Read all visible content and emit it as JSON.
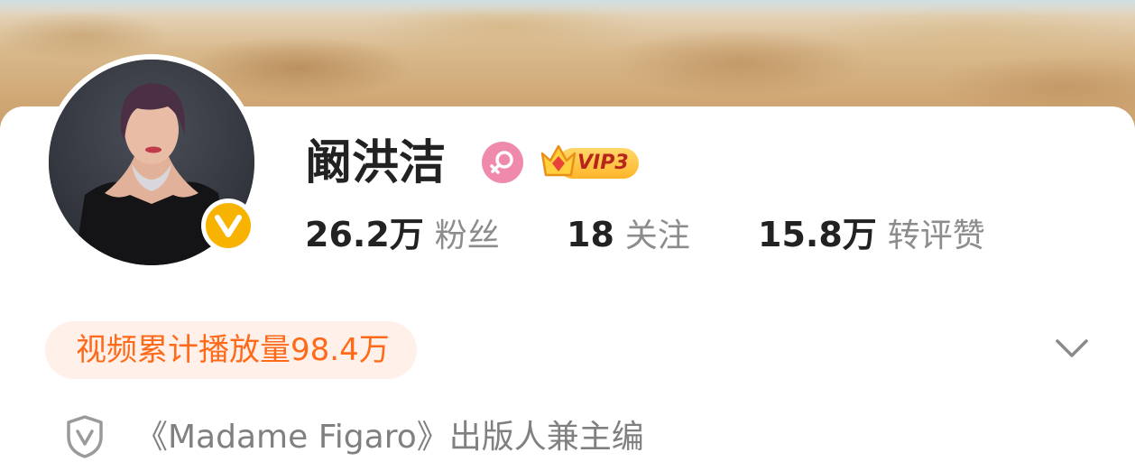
{
  "profile": {
    "name": "阚洪洁",
    "gender_icon": "female-symbol-icon",
    "vip_badge": "VIP3",
    "verified_icon": "verified-v-icon",
    "avatar_icon": "profile-photo"
  },
  "stats": [
    {
      "value": "26.2万",
      "label": "粉丝"
    },
    {
      "value": "18",
      "label": "关注"
    },
    {
      "value": "15.8万",
      "label": "转评赞"
    }
  ],
  "video_play_count": "视频累计播放量98.4万",
  "expand_icon": "chevron-down-icon",
  "bio": {
    "icon": "shield-v-icon",
    "text": "《Madame Figaro》出版人兼主编"
  },
  "colors": {
    "accent_orange": "#ff6a1a",
    "verified_gold": "#f7b300",
    "female_pink": "#f08aac",
    "pill_bg": "#fff1ea"
  }
}
